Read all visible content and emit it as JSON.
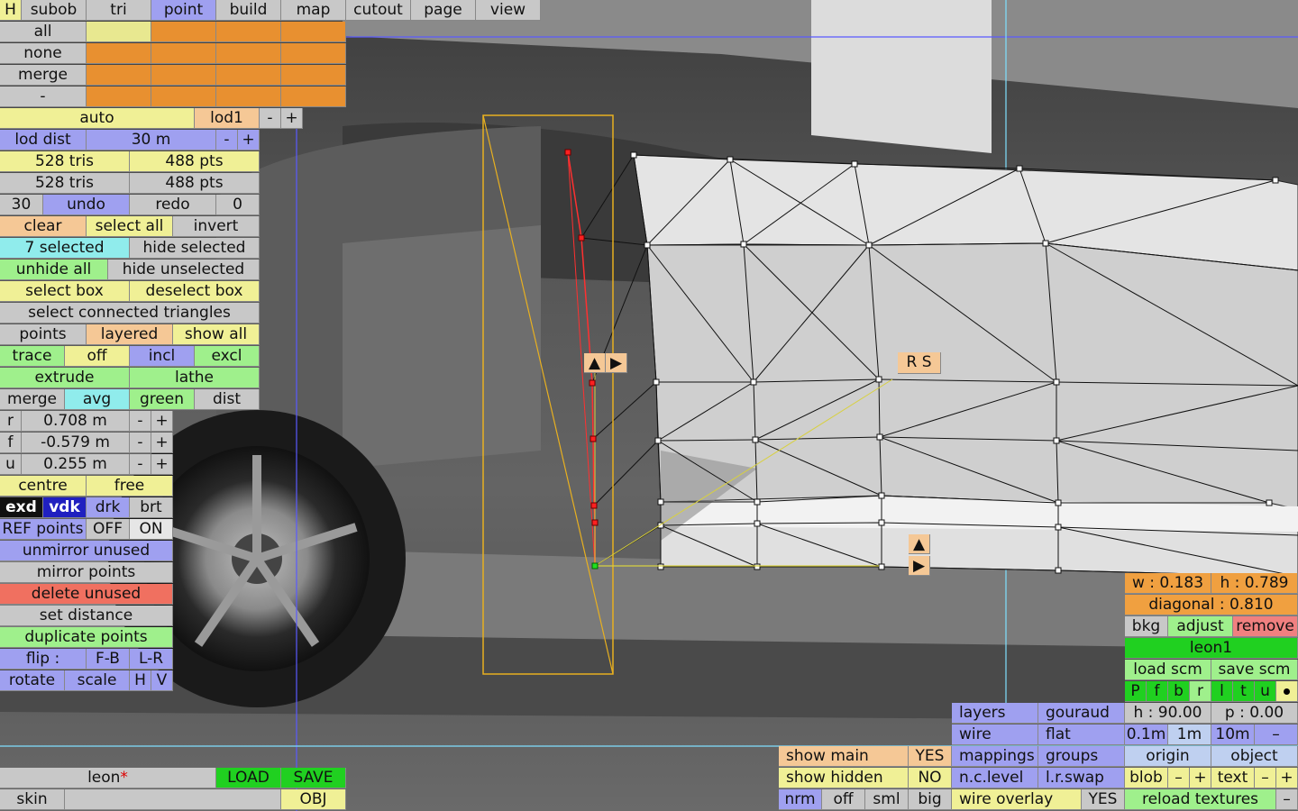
{
  "menu": {
    "h": "H",
    "items": [
      "subob",
      "tri",
      "point",
      "build",
      "map",
      "cutout",
      "page",
      "view"
    ]
  },
  "sel_rows": {
    "all": "all",
    "none": "none",
    "merge": "merge",
    "dash": "-"
  },
  "lod": {
    "auto": "auto",
    "name": "lod1",
    "minus": "-",
    "plus": "+",
    "dist_label": "lod dist",
    "dist_value": "30 m"
  },
  "counts": {
    "tris1": "528 tris",
    "pts1": "488 pts",
    "tris2": "528 tris",
    "pts2": "488 pts"
  },
  "undo": {
    "n": "30",
    "undo": "undo",
    "redo": "redo",
    "r": "0"
  },
  "selection": {
    "clear": "clear",
    "select_all": "select all",
    "invert": "invert",
    "selected": "7 selected",
    "hide_selected": "hide selected",
    "unhide_all": "unhide all",
    "hide_unselected": "hide unselected",
    "select_box": "select box",
    "deselect_box": "deselect box",
    "connected": "select connected triangles"
  },
  "points_row": {
    "points": "points",
    "layered": "layered",
    "show_all": "show all"
  },
  "trace_row": {
    "trace": "trace",
    "off": "off",
    "incl": "incl",
    "excl": "excl"
  },
  "extrude_row": {
    "extrude": "extrude",
    "lathe": "lathe"
  },
  "merge_row": {
    "merge": "merge",
    "avg": "avg",
    "green": "green",
    "dist": "dist"
  },
  "coords": {
    "r_label": "r",
    "r": "0.708 m",
    "f_label": "f",
    "f": "-0.579 m",
    "u_label": "u",
    "u": "0.255 m"
  },
  "centre": "centre",
  "free": "free",
  "display": {
    "exd": "exd",
    "vdk": "vdk",
    "drk": "drk",
    "brt": "brt"
  },
  "ref": {
    "label": "REF points",
    "off": "OFF",
    "on": "ON"
  },
  "actions": {
    "unmirror": "unmirror unused",
    "mirror": "mirror points",
    "delete": "delete unused",
    "set_distance": "set distance",
    "duplicate": "duplicate points"
  },
  "flip": {
    "label": "flip :",
    "fb": "F-B",
    "lr": "L-R"
  },
  "transform": {
    "rotate": "rotate",
    "scale": "scale",
    "h": "H",
    "v": "V"
  },
  "file": {
    "name": "leon",
    "modified": "*",
    "load": "LOAD",
    "save": "SAVE",
    "skin": "skin",
    "obj": "OBJ"
  },
  "viewport": {
    "rs": "R S",
    "up_arrow": "▲",
    "right_arrow": "▶"
  },
  "bottom_mid": {
    "show_main": "show main",
    "yes": "YES",
    "show_hidden": "show hidden",
    "no": "NO",
    "nrm": "nrm",
    "off": "off",
    "sml": "sml",
    "big": "big"
  },
  "layers": {
    "layers": "layers",
    "gouraud": "gouraud",
    "wire": "wire",
    "flat": "flat",
    "mappings": "mappings",
    "groups": "groups",
    "nclevel": "n.c.level",
    "lrswap": "l.r.swap",
    "wire_overlay": "wire overlay",
    "yes": "YES"
  },
  "ref_panel": {
    "w": "w : 0.183",
    "h": "h : 0.789",
    "diagonal": "diagonal : 0.810",
    "bkg": "bkg",
    "adjust": "adjust",
    "remove": "remove",
    "name": "leon1",
    "load_scm": "load scm",
    "save_scm": "save scm",
    "letters": [
      "P",
      "f",
      "b",
      "r",
      "l",
      "t",
      "u"
    ],
    "hdeg": "h : 90.00",
    "pdeg": "p : 0.00",
    "s01": "0.1m",
    "s1": "1m",
    "s10": "10m",
    "dash": "–",
    "origin": "origin",
    "object": "object",
    "blob": "blob",
    "text": "text",
    "minus": "–",
    "plus": "+",
    "reload": "reload textures",
    "rdash": "–"
  }
}
